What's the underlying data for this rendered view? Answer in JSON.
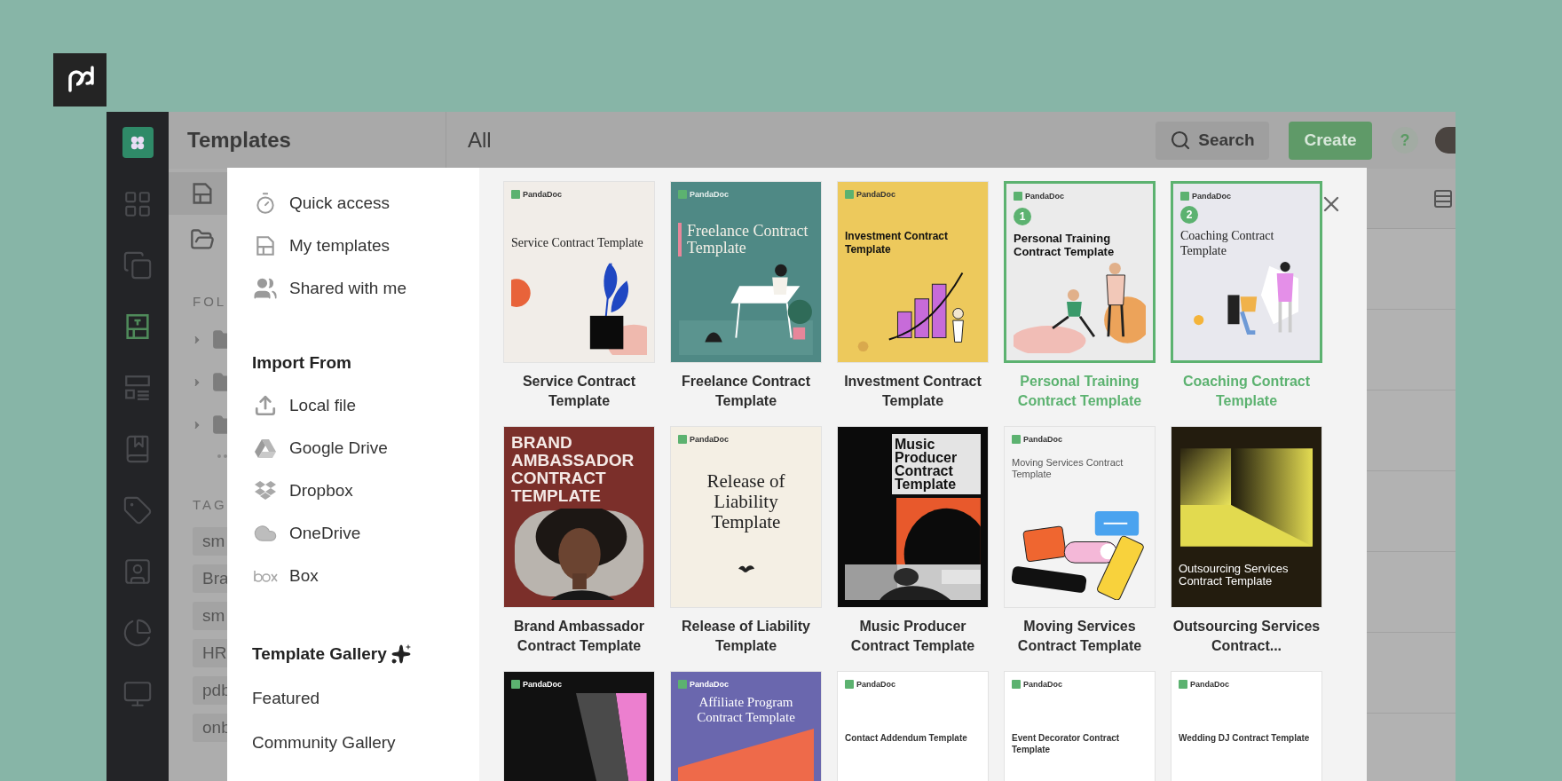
{
  "nav_rail": {
    "items": [
      {
        "kind": "grid",
        "selected": false
      },
      {
        "kind": "documents",
        "selected": false
      },
      {
        "kind": "templates",
        "selected": true
      },
      {
        "kind": "layout",
        "selected": false
      },
      {
        "kind": "library",
        "selected": false
      },
      {
        "kind": "tag",
        "selected": false
      },
      {
        "kind": "contact",
        "selected": false
      },
      {
        "kind": "chart",
        "selected": false
      },
      {
        "kind": "display",
        "selected": false
      }
    ]
  },
  "templates_panel": {
    "title": "Templates",
    "items": [
      {
        "kind": "my-templates",
        "selected": true
      },
      {
        "kind": "shared-folder",
        "selected": false
      }
    ],
    "folders_label": "FOL",
    "folders": [
      {
        "kind": "folder"
      },
      {
        "kind": "folder"
      },
      {
        "kind": "folder"
      }
    ],
    "tags_label": "TAG",
    "tags": [
      "sm",
      "Bra",
      "sm",
      "HR",
      "pdb",
      "onb"
    ]
  },
  "top_bar": {
    "title": "All",
    "search_label": "Search",
    "create_label": "Create",
    "help_label": "?"
  },
  "modal": {
    "sections": [
      {
        "items": [
          {
            "kind": "clock",
            "label": "Quick access"
          },
          {
            "kind": "template",
            "label": "My templates"
          },
          {
            "kind": "people",
            "label": "Shared with me"
          }
        ]
      },
      {
        "heading": "Import From",
        "items": [
          {
            "kind": "upload",
            "label": "Local file"
          },
          {
            "kind": "drive",
            "label": "Google Drive"
          },
          {
            "kind": "dropbox",
            "label": "Dropbox"
          },
          {
            "kind": "cloud",
            "label": "OneDrive"
          },
          {
            "kind": "box",
            "label": "Box"
          }
        ]
      },
      {
        "kind": "gallery",
        "heading": "Template Gallery",
        "items": [
          {
            "kind": "link",
            "label": "Featured"
          },
          {
            "kind": "link",
            "label": "Community Gallery"
          }
        ]
      }
    ],
    "cards": [
      {
        "caption": "Service Contract Template",
        "selected": false,
        "cover": {
          "kind": "service",
          "brand": "PandaDoc",
          "title": "Service Contract Template"
        }
      },
      {
        "caption": "Freelance Contract Template",
        "selected": false,
        "cover": {
          "kind": "freelance",
          "brand": "PandaDoc",
          "title": "Freelance Contract Template"
        }
      },
      {
        "caption": "Investment Contract Template",
        "selected": false,
        "cover": {
          "kind": "investment",
          "brand": "PandaDoc",
          "title": "Investment Contract Template"
        }
      },
      {
        "caption": "Personal Training Contract Template",
        "selected": true,
        "badge": "1",
        "cover": {
          "kind": "personal",
          "brand": "PandaDoc",
          "title": "Personal Training Contract Template"
        }
      },
      {
        "caption": "Coaching Contract Template",
        "selected": true,
        "badge": "2",
        "cover": {
          "kind": "coaching",
          "brand": "PandaDoc",
          "title": "Coaching Contract Template"
        }
      },
      {
        "caption": "Brand Ambassador Contract Template",
        "selected": false,
        "cover": {
          "kind": "brand",
          "title": "BRAND AMBASSADOR CONTRACT TEMPLATE"
        }
      },
      {
        "caption": "Release of Liability Template",
        "selected": false,
        "cover": {
          "kind": "release",
          "brand": "PandaDoc",
          "title": "Release of Liability Template"
        }
      },
      {
        "caption": "Music Producer Contract Template",
        "selected": false,
        "cover": {
          "kind": "music",
          "title": "Music Producer Contract Template"
        }
      },
      {
        "caption": "Moving Services Contract Template",
        "selected": false,
        "cover": {
          "kind": "moving",
          "brand": "PandaDoc",
          "title": "Moving Services Contract Template"
        }
      },
      {
        "caption": "Outsourcing Services Contract...",
        "selected": false,
        "cover": {
          "kind": "outsourcing",
          "title": "Outsourcing Services Contract Template"
        }
      },
      {
        "selected": false,
        "cover": {
          "kind": "dark",
          "brand": "PandaDoc"
        }
      },
      {
        "selected": false,
        "cover": {
          "kind": "affiliate",
          "brand": "PandaDoc",
          "title": "Affiliate Program Contract Template"
        }
      },
      {
        "selected": false,
        "cover": {
          "kind": "plain",
          "brand": "PandaDoc",
          "title": "Contact Addendum Template"
        }
      },
      {
        "selected": false,
        "cover": {
          "kind": "plain",
          "brand": "PandaDoc",
          "title": "Event Decorator Contract Template"
        }
      },
      {
        "selected": false,
        "cover": {
          "kind": "plain",
          "brand": "PandaDoc",
          "title": "Wedding DJ Contract Template"
        }
      }
    ]
  }
}
